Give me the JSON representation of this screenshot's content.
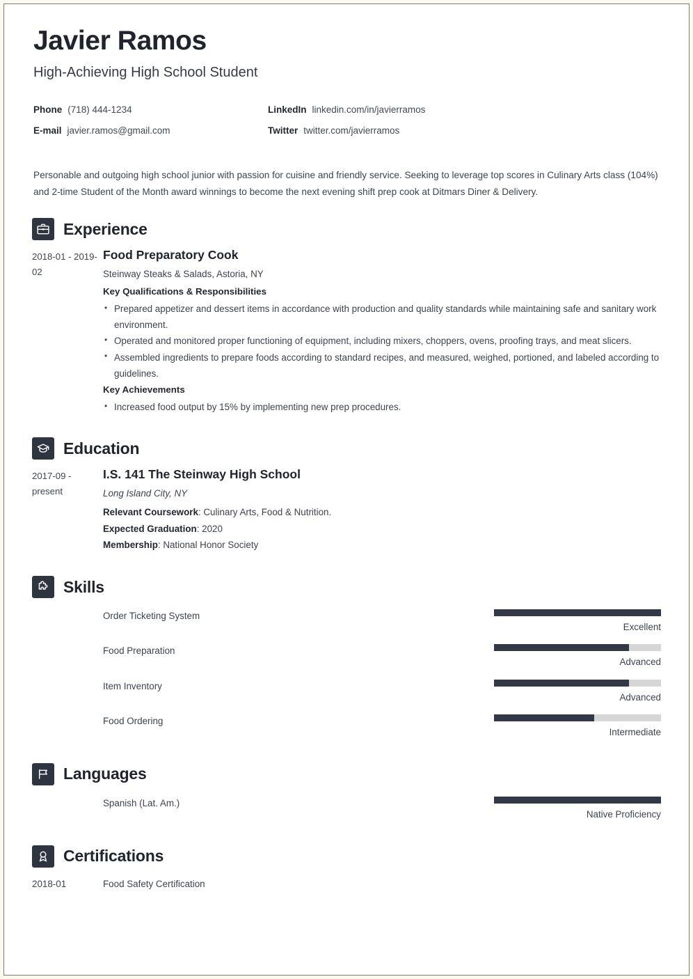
{
  "header": {
    "name": "Javier Ramos",
    "job_title": "High-Achieving High School Student",
    "contacts": [
      {
        "label": "Phone",
        "value": "(718) 444-1234"
      },
      {
        "label": "LinkedIn",
        "value": "linkedin.com/in/javierramos"
      },
      {
        "label": "E-mail",
        "value": "javier.ramos@gmail.com"
      },
      {
        "label": "Twitter",
        "value": "twitter.com/javierramos"
      }
    ]
  },
  "summary": "Personable and outgoing high school junior with passion for cuisine and friendly service. Seeking to leverage top scores in Culinary Arts class (104%) and 2-time Student of the Month award winnings to become the next evening shift prep cook at Ditmars Diner & Delivery.",
  "experience": {
    "section_title": "Experience",
    "icon": "briefcase-icon",
    "entries": [
      {
        "date": "2018-01 - 2019-02",
        "title": "Food Preparatory Cook",
        "subtitle": "Steinway Steaks & Salads, Astoria, NY",
        "qualifications_label": "Key Qualifications & Responsibilities",
        "qualifications": [
          "Prepared appetizer and dessert items in accordance with production and quality standards while maintaining safe and sanitary work environment.",
          "Operated and monitored proper functioning of equipment, including mixers, choppers, ovens, proofing trays, and meat slicers.",
          "Assembled ingredients to prepare foods according to standard recipes, and measured, weighed, portioned, and labeled according to guidelines."
        ],
        "achievements_label": "Key Achievements",
        "achievements": [
          "Increased food output by 15% by implementing new prep procedures."
        ]
      }
    ]
  },
  "education": {
    "section_title": "Education",
    "icon": "graduation-cap-icon",
    "entries": [
      {
        "date": "2017-09 - present",
        "title": "I.S. 141 The Steinway High School",
        "location": "Long Island City, NY",
        "details": [
          {
            "label": "Relevant Coursework",
            "value": ": Culinary Arts, Food & Nutrition."
          },
          {
            "label": "Expected Graduation",
            "value": ": 2020"
          },
          {
            "label": "Membership",
            "value": ": National Honor Society"
          }
        ]
      }
    ]
  },
  "skills": {
    "section_title": "Skills",
    "icon": "puzzle-piece-icon",
    "items": [
      {
        "label": "Order Ticketing System",
        "level_text": "Excellent",
        "percent": 100
      },
      {
        "label": "Food Preparation",
        "level_text": "Advanced",
        "percent": 81
      },
      {
        "label": "Item Inventory",
        "level_text": "Advanced",
        "percent": 81
      },
      {
        "label": "Food Ordering",
        "level_text": "Intermediate",
        "percent": 60
      }
    ]
  },
  "languages": {
    "section_title": "Languages",
    "icon": "flag-icon",
    "items": [
      {
        "label": "Spanish (Lat. Am.)",
        "level_text": "Native Proficiency",
        "percent": 100
      }
    ]
  },
  "certifications": {
    "section_title": "Certifications",
    "icon": "award-ribbon-icon",
    "items": [
      {
        "date": "2018-01",
        "label": "Food Safety Certification"
      }
    ]
  },
  "colors": {
    "ink": "#20242d",
    "body_text": "#3d424c",
    "icon_badge": "#2e3440",
    "bar_fill": "#323846",
    "bar_track": "#d6d6d6",
    "page_border": "#7d7f62",
    "page_margin": "#fbfaf0"
  }
}
